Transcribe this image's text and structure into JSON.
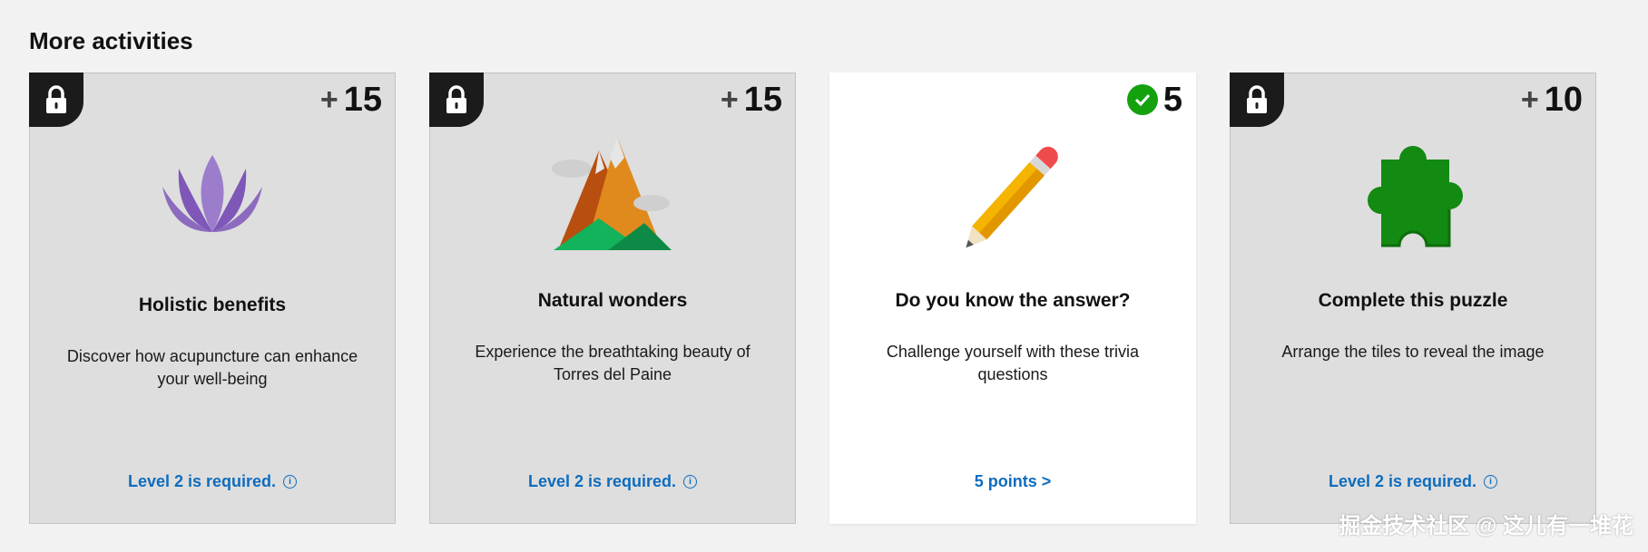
{
  "section": {
    "title": "More activities"
  },
  "cards": [
    {
      "points_prefix": "+",
      "points": "15",
      "title": "Holistic benefits",
      "description": "Discover how acupuncture can enhance your well-being",
      "footer": "Level 2 is required.",
      "locked": true,
      "icon": "lotus-icon"
    },
    {
      "points_prefix": "+",
      "points": "15",
      "title": "Natural wonders",
      "description": "Experience the breathtaking beauty of Torres del Paine",
      "footer": "Level 2 is required.",
      "locked": true,
      "icon": "mountain-icon"
    },
    {
      "points": "5",
      "title": "Do you know the answer?",
      "description": "Challenge yourself with these trivia questions",
      "footer": "5 points >",
      "locked": false,
      "completed": true,
      "icon": "pencil-icon"
    },
    {
      "points_prefix": "+",
      "points": "10",
      "title": "Complete this puzzle",
      "description": "Arrange the tiles to reveal the image",
      "footer": "Level 2 is required.",
      "locked": true,
      "icon": "puzzle-piece-icon"
    }
  ],
  "info_glyph": "i",
  "watermark": "掘金技术社区 @ 这儿有一堆花",
  "colors": {
    "accent": "#0f6cbd",
    "locked_card": "#dedede",
    "active_card": "#ffffff",
    "check": "#13a10e"
  }
}
